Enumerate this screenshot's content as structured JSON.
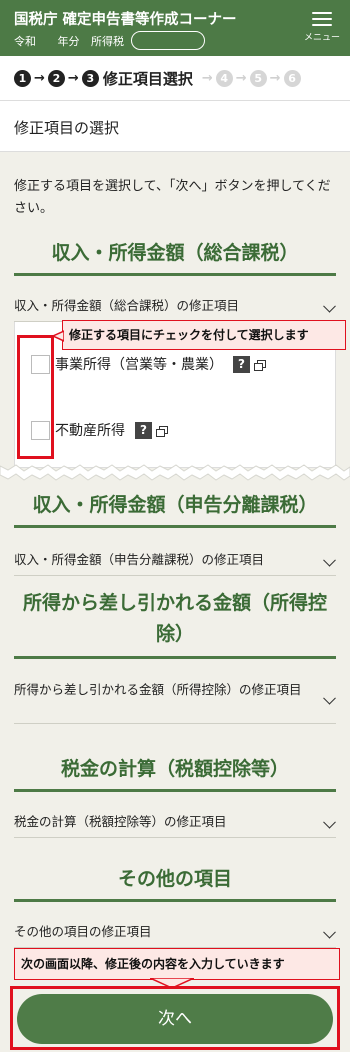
{
  "header": {
    "title": "国税庁 確定申告書等作成コーナー",
    "era": "令和",
    "year_suffix": "年分",
    "tax_type": "所得税",
    "menu_label": "メニュー"
  },
  "steps": {
    "s1": "1",
    "s2": "2",
    "s3": "3",
    "current_label": "修正項目選択",
    "s4": "4",
    "s5": "5",
    "s6": "6",
    "arrow": "→"
  },
  "section": {
    "title": "修正項目の選択"
  },
  "intro": "修正する項目を選択して、「次へ」ボタンを押してください。",
  "categories": [
    {
      "title": "収入・所得金額（総合課税）",
      "accordion": "収入・所得金額（総合課税）の修正項目"
    },
    {
      "title": "収入・所得金額（申告分離課税）",
      "accordion": "収入・所得金額（申告分離課税）の修正項目"
    },
    {
      "title": "所得から差し引かれる金額（所得控除）",
      "accordion": "所得から差し引かれる金額（所得控除）の修正項目"
    },
    {
      "title": "税金の計算（税額控除等）",
      "accordion": "税金の計算（税額控除等）の修正項目"
    },
    {
      "title": "その他の項目",
      "accordion": "その他の項目の修正項目"
    }
  ],
  "checkbox_items": [
    {
      "label": "事業所得（営業等・農業）",
      "help": "?"
    },
    {
      "label": "不動産所得",
      "help": "?"
    }
  ],
  "callouts": {
    "checkbox_tip": "修正する項目にチェックを付して選択します",
    "next_tip": "次の画面以降、修正後の内容を入力していきます"
  },
  "next_button": "次へ",
  "colors": {
    "header": "#4d7a46",
    "accent_text": "#3b6b36",
    "highlight": "#e0101e",
    "callout_bg": "#fde8e5"
  }
}
